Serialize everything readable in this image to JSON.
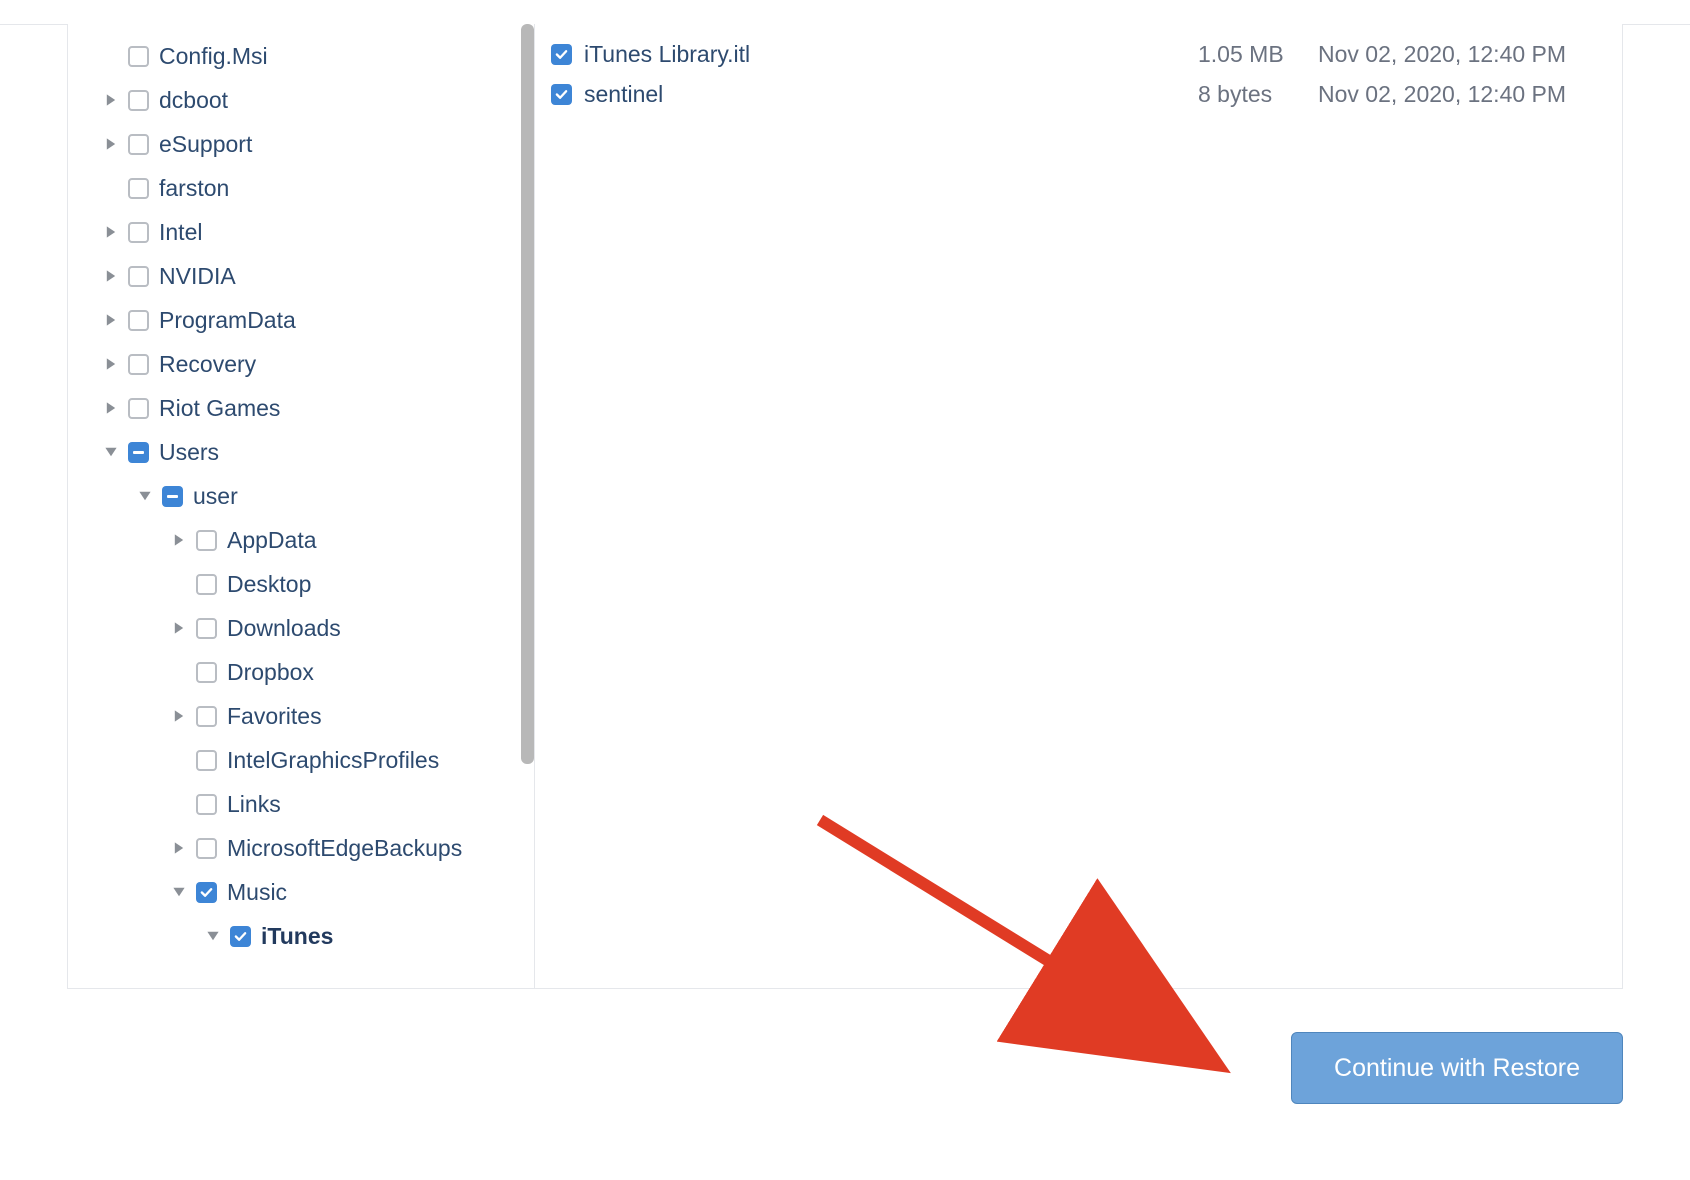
{
  "colors": {
    "accent": "#3d85d6",
    "text": "#2d4a6f",
    "muted": "#6b7280",
    "button": "#6da3da"
  },
  "tree": [
    {
      "label": "Config.Msi",
      "state": "empty",
      "expandable": false,
      "depth": 0
    },
    {
      "label": "dcboot",
      "state": "empty",
      "expandable": true,
      "expanded": false,
      "depth": 0
    },
    {
      "label": "eSupport",
      "state": "empty",
      "expandable": true,
      "expanded": false,
      "depth": 0
    },
    {
      "label": "farston",
      "state": "empty",
      "expandable": false,
      "depth": 0
    },
    {
      "label": "Intel",
      "state": "empty",
      "expandable": true,
      "expanded": false,
      "depth": 0
    },
    {
      "label": "NVIDIA",
      "state": "empty",
      "expandable": true,
      "expanded": false,
      "depth": 0
    },
    {
      "label": "ProgramData",
      "state": "empty",
      "expandable": true,
      "expanded": false,
      "depth": 0
    },
    {
      "label": "Recovery",
      "state": "empty",
      "expandable": true,
      "expanded": false,
      "depth": 0
    },
    {
      "label": "Riot Games",
      "state": "empty",
      "expandable": true,
      "expanded": false,
      "depth": 0
    },
    {
      "label": "Users",
      "state": "partial",
      "expandable": true,
      "expanded": true,
      "depth": 0
    },
    {
      "label": "user",
      "state": "partial",
      "expandable": true,
      "expanded": true,
      "depth": 1
    },
    {
      "label": "AppData",
      "state": "empty",
      "expandable": true,
      "expanded": false,
      "depth": 2
    },
    {
      "label": "Desktop",
      "state": "empty",
      "expandable": false,
      "depth": 2
    },
    {
      "label": "Downloads",
      "state": "empty",
      "expandable": true,
      "expanded": false,
      "depth": 2
    },
    {
      "label": "Dropbox",
      "state": "empty",
      "expandable": false,
      "depth": 2
    },
    {
      "label": "Favorites",
      "state": "empty",
      "expandable": true,
      "expanded": false,
      "depth": 2
    },
    {
      "label": "IntelGraphicsProfiles",
      "state": "empty",
      "expandable": false,
      "depth": 2
    },
    {
      "label": "Links",
      "state": "empty",
      "expandable": false,
      "depth": 2
    },
    {
      "label": "MicrosoftEdgeBackups",
      "state": "empty",
      "expandable": true,
      "expanded": false,
      "depth": 2
    },
    {
      "label": "Music",
      "state": "checked",
      "expandable": true,
      "expanded": true,
      "depth": 2
    },
    {
      "label": "iTunes",
      "state": "checked",
      "expandable": true,
      "expanded": true,
      "depth": 3,
      "bold": true
    }
  ],
  "files": [
    {
      "name": "iTunes Library.itl",
      "size": "1.05 MB",
      "date": "Nov 02, 2020, 12:40 PM",
      "state": "checked"
    },
    {
      "name": "sentinel",
      "size": "8 bytes",
      "date": "Nov 02, 2020, 12:40 PM",
      "state": "checked"
    }
  ],
  "footer": {
    "button_label": "Continue with Restore"
  }
}
